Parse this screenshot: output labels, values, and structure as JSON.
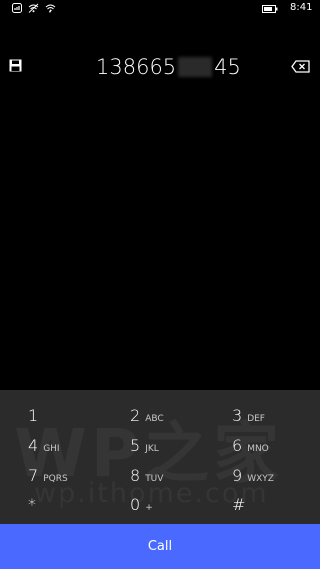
{
  "status_bar": {
    "time": "8:41",
    "icons": [
      "signal-icon",
      "wifi-icon",
      "sync-icon",
      "battery-icon"
    ]
  },
  "dialer": {
    "number_prefix": "138665",
    "number_suffix": "45",
    "save_icon": "save-icon",
    "backspace_icon": "backspace-icon"
  },
  "keypad": {
    "watermark_text": "WP之家",
    "watermark_url": "wp.ithome.com",
    "keys": [
      {
        "digit": "1",
        "letters": ""
      },
      {
        "digit": "2",
        "letters": "ABC"
      },
      {
        "digit": "3",
        "letters": "DEF"
      },
      {
        "digit": "4",
        "letters": "GHI"
      },
      {
        "digit": "5",
        "letters": "JKL"
      },
      {
        "digit": "6",
        "letters": "MNO"
      },
      {
        "digit": "7",
        "letters": "PQRS"
      },
      {
        "digit": "8",
        "letters": "TUV"
      },
      {
        "digit": "9",
        "letters": "WXYZ"
      },
      {
        "digit": "*",
        "letters": ""
      },
      {
        "digit": "0",
        "letters": "+"
      },
      {
        "digit": "#",
        "letters": ""
      }
    ]
  },
  "call_button": {
    "label": "Call",
    "color": "#4a69ff"
  }
}
